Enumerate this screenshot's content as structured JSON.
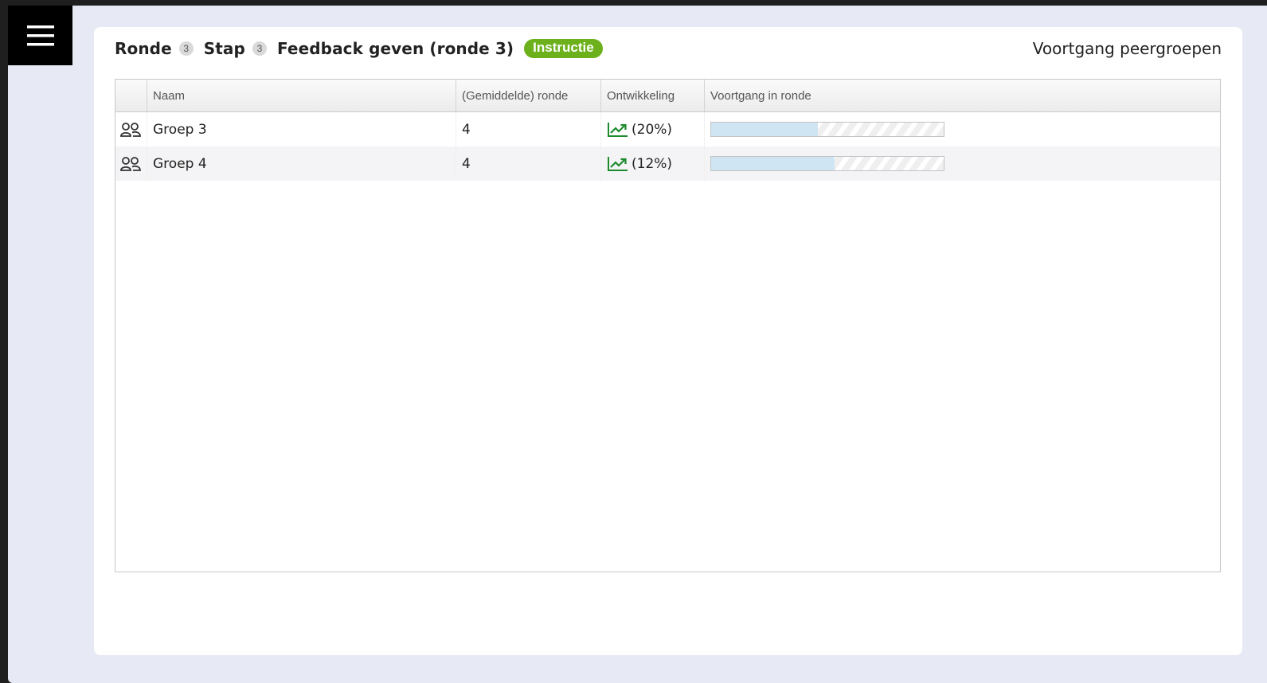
{
  "menu": {
    "icon": "hamburger-icon"
  },
  "header": {
    "round_label": "Ronde",
    "round_number": "3",
    "step_label": "Stap",
    "step_number": "3",
    "step_title": "Feedback geven (ronde 3)",
    "instruction_label": "Instructie",
    "right_title": "Voortgang peergroepen"
  },
  "colors": {
    "accent_green": "#6cb11b",
    "trend_green": "#1e8a2e",
    "progress_fill": "#cfe5f3"
  },
  "table": {
    "columns": [
      "",
      "Naam",
      "(Gemiddelde) ronde",
      "Ontwikkeling",
      "Voortgang in ronde"
    ],
    "rows": [
      {
        "icon": "group-icon",
        "name": "Groep 3",
        "round": "4",
        "trend_icon": "trending-up-icon",
        "development": "(20%)",
        "progress": 0.46
      },
      {
        "icon": "group-icon",
        "name": "Groep 4",
        "round": "4",
        "trend_icon": "trending-up-icon",
        "development": "(12%)",
        "progress": 0.53
      }
    ]
  }
}
